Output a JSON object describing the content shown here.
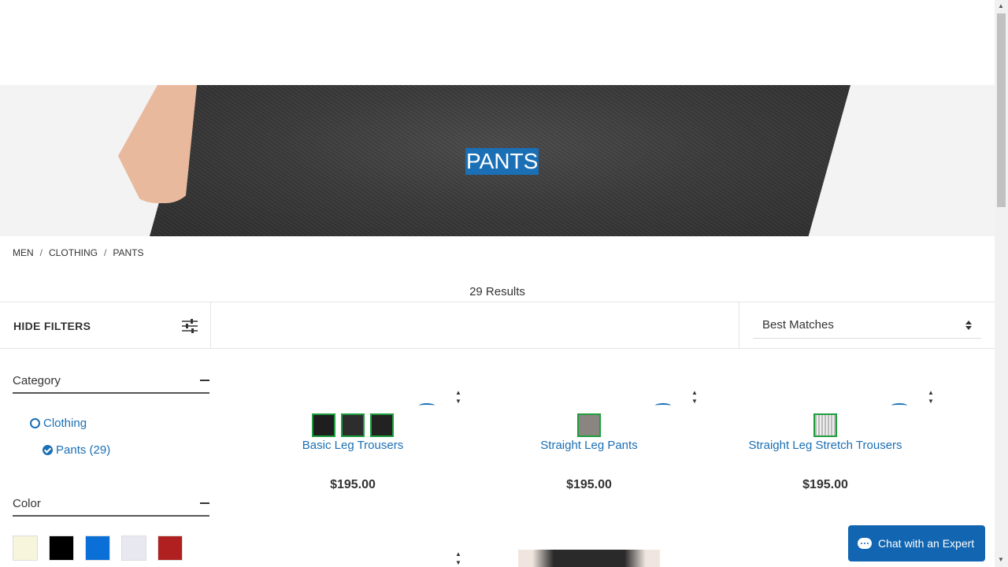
{
  "hero": {
    "title": "PANTS"
  },
  "breadcrumb": [
    "MEN",
    "CLOTHING",
    "PANTS"
  ],
  "results_text": "29 Results",
  "toolbar": {
    "hide_filters": "HIDE FILTERS",
    "sort_selected": "Best Matches"
  },
  "filters": {
    "category": {
      "title": "Category",
      "items": [
        {
          "label": "Clothing",
          "state": "unchecked"
        },
        {
          "label": "Pants (29)",
          "state": "checked"
        }
      ]
    },
    "color": {
      "title": "Color",
      "swatches": [
        "#f7f5dc",
        "#000000",
        "#0b6fd8",
        "#e8e8f0",
        "#b02020"
      ]
    }
  },
  "products": [
    {
      "name": "Basic Leg Trousers",
      "price": "$195.00",
      "colors": [
        "#1e1e1e",
        "#2d2d2d",
        "#222222"
      ]
    },
    {
      "name": "Straight Leg Pants",
      "price": "$195.00",
      "colors": [
        "#8a8580"
      ]
    },
    {
      "name": "Straight Leg Stretch Trousers",
      "price": "$195.00",
      "colors": [
        "#d9d9d9"
      ]
    }
  ],
  "chat": {
    "label": "Chat with an Expert"
  },
  "colors": {
    "accent": "#1b6fb5",
    "chat_bg": "#1266b1",
    "swatch_border": "#1e9e3e"
  }
}
